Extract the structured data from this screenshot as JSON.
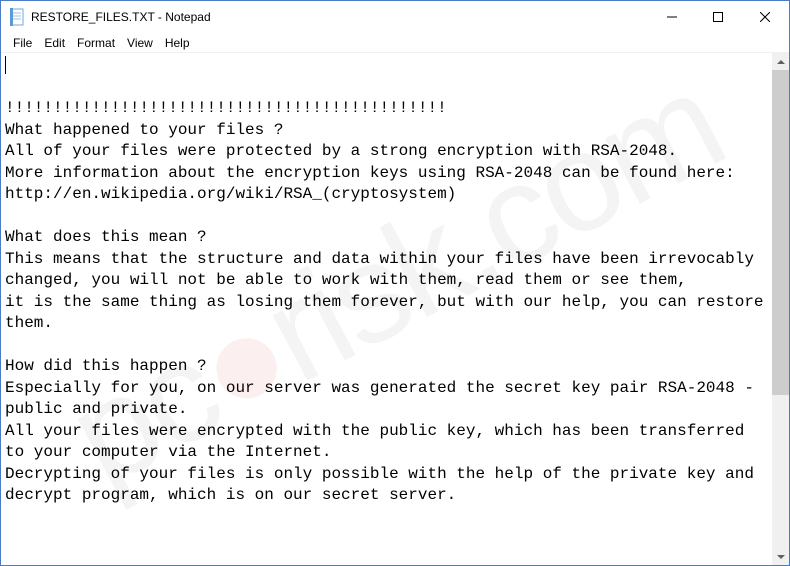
{
  "titlebar": {
    "title": "RESTORE_FILES.TXT - Notepad"
  },
  "menu": {
    "file": "File",
    "edit": "Edit",
    "format": "Format",
    "view": "View",
    "help": "Help"
  },
  "content": {
    "text": "\n!!!!!!!!!!!!!!!!!!!!!!!!!!!!!!!!!!!!!!!!!!!!!!\nWhat happened to your files ?\nAll of your files were protected by a strong encryption with RSA-2048.\nMore information about the encryption keys using RSA-2048 can be found here: http://en.wikipedia.org/wiki/RSA_(cryptosystem)\n\nWhat does this mean ?\nThis means that the structure and data within your files have been irrevocably changed, you will not be able to work with them, read them or see them,\nit is the same thing as losing them forever, but with our help, you can restore them.\n\nHow did this happen ?\nEspecially for you, on our server was generated the secret key pair RSA-2048 - public and private.\nAll your files were encrypted with the public key, which has been transferred to your computer via the Internet.\nDecrypting of your files is only possible with the help of the private key and decrypt program, which is on our secret server."
  },
  "watermark": {
    "left": "pc",
    "right": "risk.com"
  }
}
